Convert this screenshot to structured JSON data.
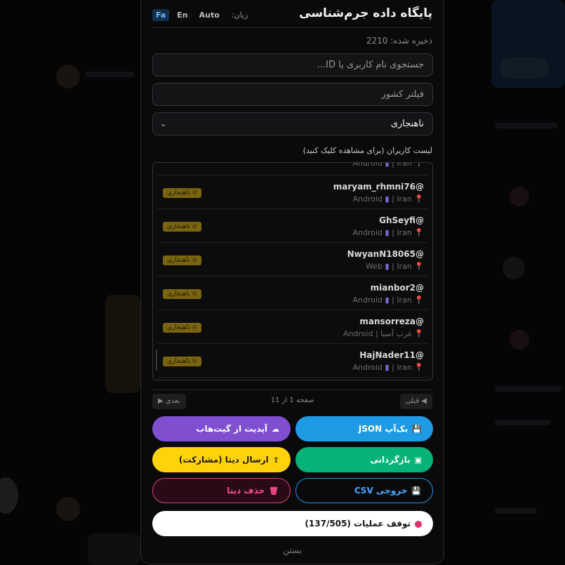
{
  "header": {
    "title": "پایگاه داده جرم‌شناسی",
    "lang_label": "زبان:",
    "lang_options": [
      "Auto",
      "En",
      "Fa"
    ],
    "lang_active": "Fa"
  },
  "saved": "ذخیره شده: 2210",
  "search": {
    "placeholder": "جستجوی نام کاربری یا ID..."
  },
  "country_filter": {
    "placeholder": "فیلتر کشور"
  },
  "category_select": {
    "value": "ناهنجاری",
    "chevron_icon": "chevron-down-icon"
  },
  "list_caption": "لیست کاربران (برای مشاهده کلیک کنید)",
  "users": [
    {
      "username": "maryam_rhmni76@",
      "platform": "Android",
      "country": "Iran",
      "badge": "ناهنجاری"
    },
    {
      "username": "GhSeyfi@",
      "platform": "Android",
      "country": "Iran",
      "badge": "ناهنجاری"
    },
    {
      "username": "NwyanN18065@",
      "platform": "Web",
      "country": "Iran",
      "badge": "ناهنجاری"
    },
    {
      "username": "mianbor2@",
      "platform": "Android",
      "country": "Iran",
      "badge": "ناهنجاری"
    },
    {
      "username": "mansorreza@",
      "platform": "Android",
      "country": "غرب آسیا",
      "badge": "ناهنجاری"
    },
    {
      "username": "HajNader11@",
      "platform": "Android",
      "country": "Iran",
      "badge": "ناهنجاری"
    }
  ],
  "partial_row": {
    "platform": "Android",
    "country": "Iran"
  },
  "pager": {
    "prev": "◀ قبلی",
    "next": "بعدی ▶",
    "info": "صفحه 1 از 11"
  },
  "actions": {
    "backup_json": "بک‌آپ JSON",
    "github_update": "آپدیت از گیت‌هاب",
    "restore": "بازگردانی",
    "send_data": "ارسال دیتا (مشارکت)",
    "export_csv": "خروجی CSV",
    "delete_data": "حذف دیتا",
    "stop_op": "توقف عملیات (137/505)"
  },
  "close": "بستن",
  "colors": {
    "purple": "#7f4fd0",
    "blue": "#1f9be6",
    "yellow": "#ffd20a",
    "green": "#08b37a",
    "pink": "#e0407c",
    "badge": "#7a6410"
  }
}
